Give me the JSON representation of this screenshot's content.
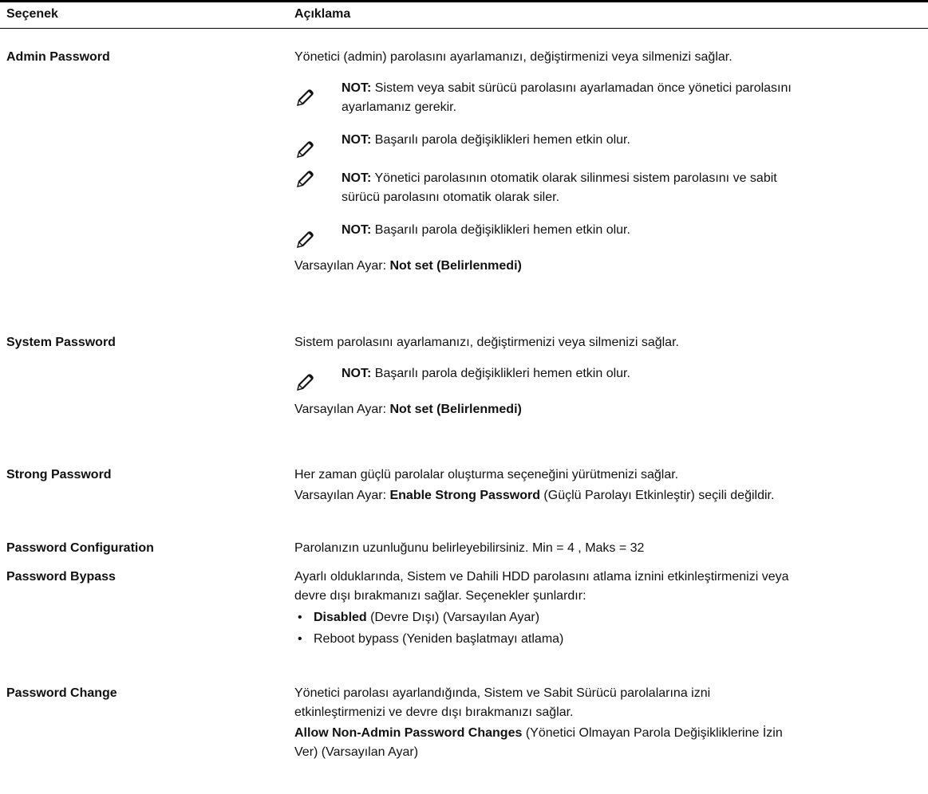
{
  "header": {
    "col_option": "Seçenek",
    "col_desc": "Açıklama"
  },
  "note_label": "NOT:",
  "default_label": "Varsayılan Ayar:",
  "icon": "pen-note-icon",
  "rows": [
    {
      "option": "Admin Password",
      "intro": "Yönetici (admin) parolasını ayarlamanızı, değiştirmenizi veya silmenizi sağlar.",
      "notes": [
        {
          "line1": "Sistem veya sabit sürücü parolasını ayarlamadan önce yönetici parolasını",
          "line2": "ayarlamanız gerekir."
        },
        {
          "line1": "Başarılı parola değişiklikleri hemen etkin olur."
        },
        {
          "line1": "Yönetici parolasının otomatik olarak silinmesi sistem parolasını ve sabit",
          "line2": "sürücü parolasını otomatik olarak siler."
        },
        {
          "line1": "Başarılı parola değişiklikleri hemen etkin olur."
        }
      ],
      "default": "Not set (Belirlenmedi)"
    },
    {
      "option": "System Password",
      "intro": "Sistem parolasını ayarlamanızı, değiştirmenizi veya silmenizi sağlar.",
      "notes": [
        {
          "line1": "Başarılı parola değişiklikleri hemen etkin olur."
        }
      ],
      "default": "Not set (Belirlenmedi)"
    },
    {
      "option": "Strong Password",
      "intro": "Her zaman güçlü parolalar oluşturma seçeneğini yürütmenizi sağlar.",
      "default_bold": "Enable Strong Password",
      "default_rest": "(Güçlü Parolayı Etkinleştir) seçili değildir."
    },
    {
      "option": "Password Configuration",
      "intro": "Parolanızın uzunluğunu belirleyebilirsiniz. Min = 4 , Maks = 32"
    },
    {
      "option": "Password Bypass",
      "intro_line1": "Ayarlı olduklarında, Sistem ve Dahili HDD parolasını atlama iznini etkinleştirmenizi veya",
      "intro_line2": "devre dışı bırakmanızı sağlar. Seçenekler şunlardır:",
      "bullets": [
        {
          "bold": "Disabled",
          "rest": "(Devre Dışı) (Varsayılan Ayar)"
        },
        {
          "bold": "",
          "rest": "Reboot bypass (Yeniden başlatmayı atlama)"
        }
      ]
    },
    {
      "option": "Password Change",
      "intro_line1": "Yönetici parolası ayarlandığında, Sistem ve Sabit Sürücü parolalarına izni",
      "intro_line2": "etkinleştirmenizi ve devre dışı bırakmanızı sağlar.",
      "value_bold": "Allow Non-Admin Password Changes",
      "value_rest_line1": "(Yönetici Olmayan Parola Değişikliklerine İzin",
      "value_rest_line2": "Ver) (Varsayılan Ayar)"
    }
  ]
}
